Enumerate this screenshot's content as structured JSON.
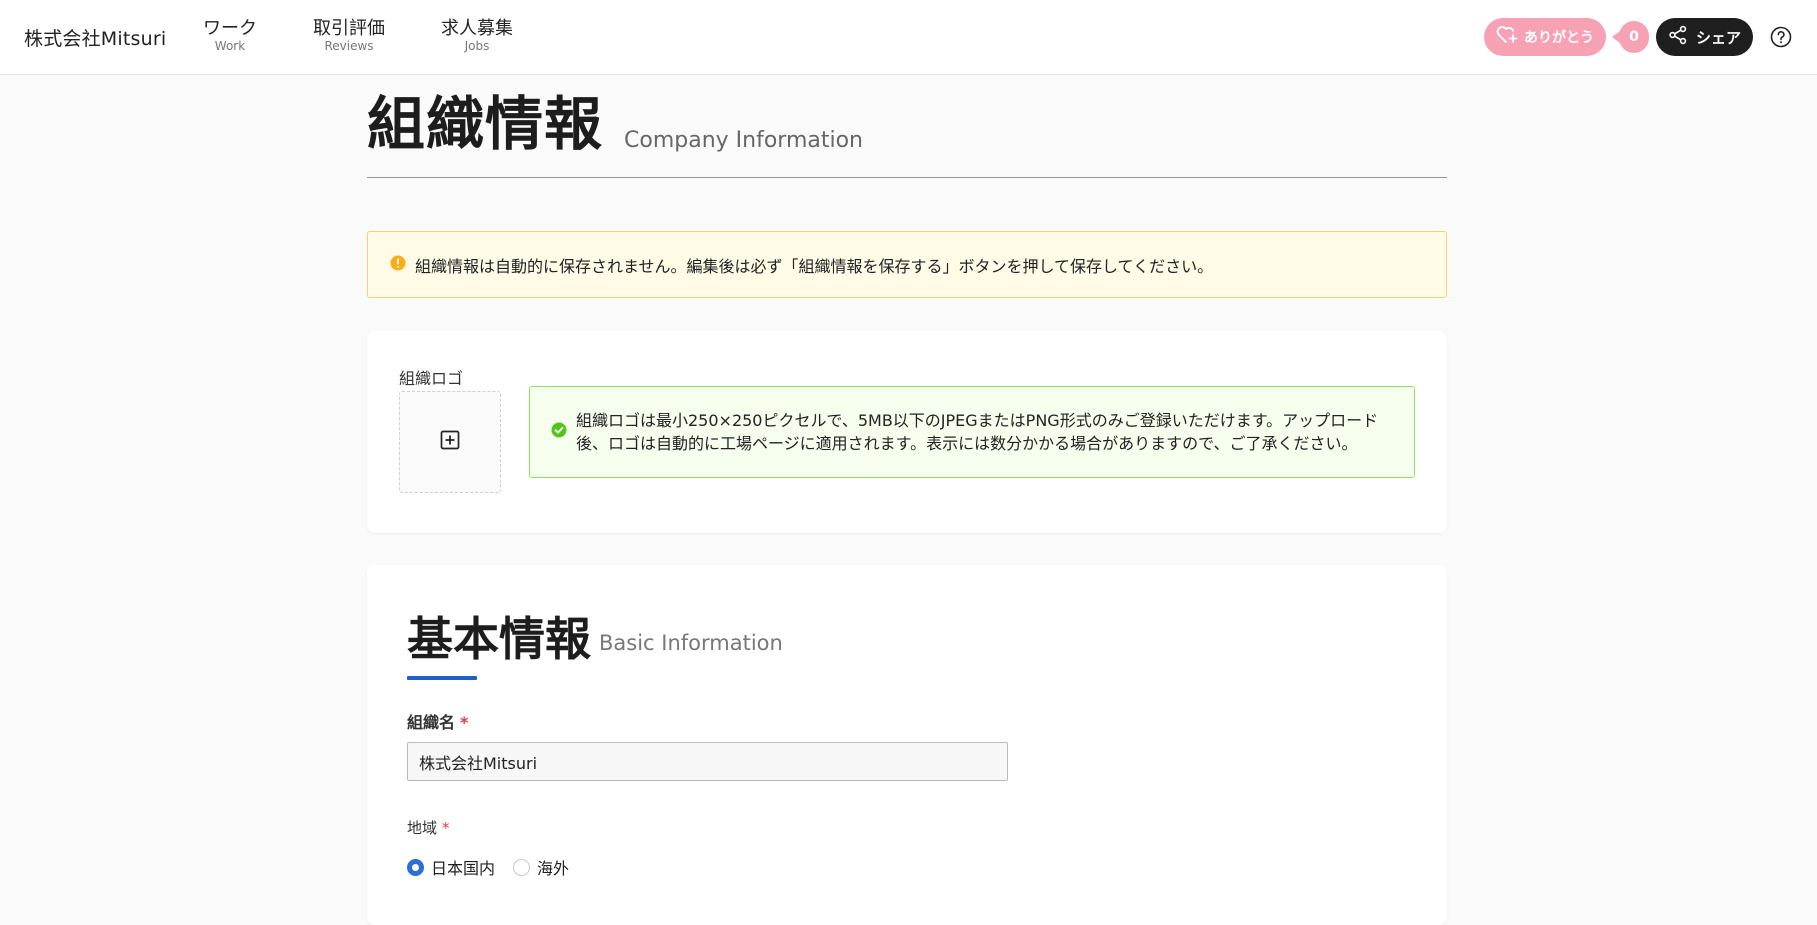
{
  "header": {
    "brand": "株式会社Mitsuri",
    "nav": [
      {
        "label": "ワーク",
        "sub": "Work"
      },
      {
        "label": "取引評価",
        "sub": "Reviews"
      },
      {
        "label": "求人募集",
        "sub": "Jobs"
      }
    ],
    "thanks_label": "ありがとう",
    "thanks_count": "0",
    "share_label": "シェア"
  },
  "page": {
    "title": "組織情報",
    "subtitle": "Company Information"
  },
  "warning": {
    "text": "組織情報は自動的に保存されません。編集後は必ず「組織情報を保存する」ボタンを押して保存してください。"
  },
  "logo_section": {
    "label": "組織ロゴ",
    "info": "組織ロゴは最小250×250ピクセルで、5MB以下のJPEGまたはPNG形式のみご登録いただけます。アップロード後、ロゴは自動的に工場ページに適用されます。表示には数分かかる場合がありますので、ご了承ください。"
  },
  "basic_info": {
    "title": "基本情報",
    "subtitle": "Basic Information",
    "org_name_label": "組織名",
    "org_name_value": "株式会社Mitsuri",
    "required_mark": "*",
    "region_label": "地域",
    "region_options": [
      "日本国内",
      "海外"
    ],
    "region_selected": "日本国内"
  },
  "colors": {
    "accent": "#1f5fc7",
    "thanks": "#f7a2b4",
    "warning_bg": "#fffbe6",
    "success_border": "#95de64"
  }
}
